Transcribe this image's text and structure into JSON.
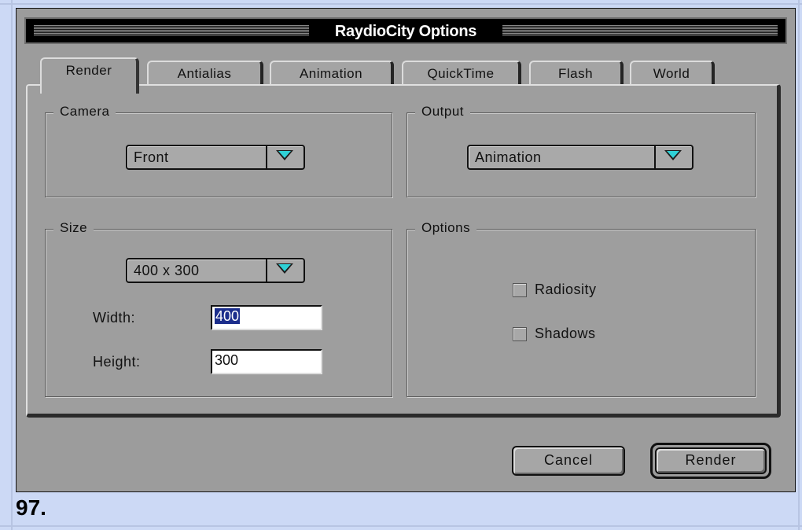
{
  "window": {
    "title": "RaydioCity Options"
  },
  "tabs": [
    {
      "label": "Render",
      "active": true
    },
    {
      "label": "Antialias",
      "active": false
    },
    {
      "label": "Animation",
      "active": false
    },
    {
      "label": "QuickTime",
      "active": false
    },
    {
      "label": "Flash",
      "active": false
    },
    {
      "label": "World",
      "active": false
    }
  ],
  "camera": {
    "label": "Camera",
    "value": "Front"
  },
  "output": {
    "label": "Output",
    "value": "Animation"
  },
  "size": {
    "label": "Size",
    "preset": "400 x 300",
    "width_label": "Width:",
    "width_value": "400",
    "height_label": "Height:",
    "height_value": "300"
  },
  "options": {
    "label": "Options",
    "radiosity_label": "Radiosity",
    "radiosity_checked": false,
    "shadows_label": "Shadows",
    "shadows_checked": false
  },
  "buttons": {
    "cancel": "Cancel",
    "render": "Render"
  },
  "caption": "97.",
  "colors": {
    "accent_arrow": "#2fd1d6",
    "selection": "#1c2e8c",
    "page_background": "#ccd9f5"
  }
}
